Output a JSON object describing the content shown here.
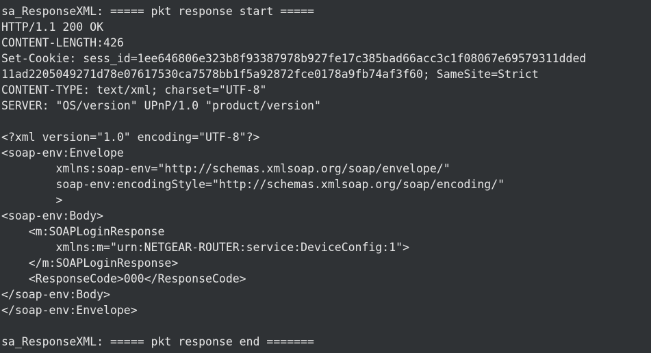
{
  "terminal": {
    "lines": [
      "sa_ResponseXML: ===== pkt response start =====",
      "HTTP/1.1 200 OK",
      "CONTENT-LENGTH:426",
      "Set-Cookie: sess_id=1ee646806e323b8f93387978b927fe17c385bad66acc3c1f08067e69579311dded",
      "11ad2205049271d78e07617530ca7578bb1f5a92872fce0178a9fb74af3f60; SameSite=Strict",
      "CONTENT-TYPE: text/xml; charset=\"UTF-8\"",
      "SERVER: \"OS/version\" UPnP/1.0 \"product/version\"",
      "",
      "<?xml version=\"1.0\" encoding=\"UTF-8\"?>",
      "<soap-env:Envelope",
      "        xmlns:soap-env=\"http://schemas.xmlsoap.org/soap/envelope/\"",
      "        soap-env:encodingStyle=\"http://schemas.xmlsoap.org/soap/encoding/\"",
      "        >",
      "<soap-env:Body>",
      "    <m:SOAPLoginResponse",
      "        xmlns:m=\"urn:NETGEAR-ROUTER:service:DeviceConfig:1\">",
      "    </m:SOAPLoginResponse>",
      "    <ResponseCode>000</ResponseCode>",
      "</soap-env:Body>",
      "</soap-env:Envelope>",
      "",
      "sa_ResponseXML: ===== pkt response end ======="
    ]
  }
}
